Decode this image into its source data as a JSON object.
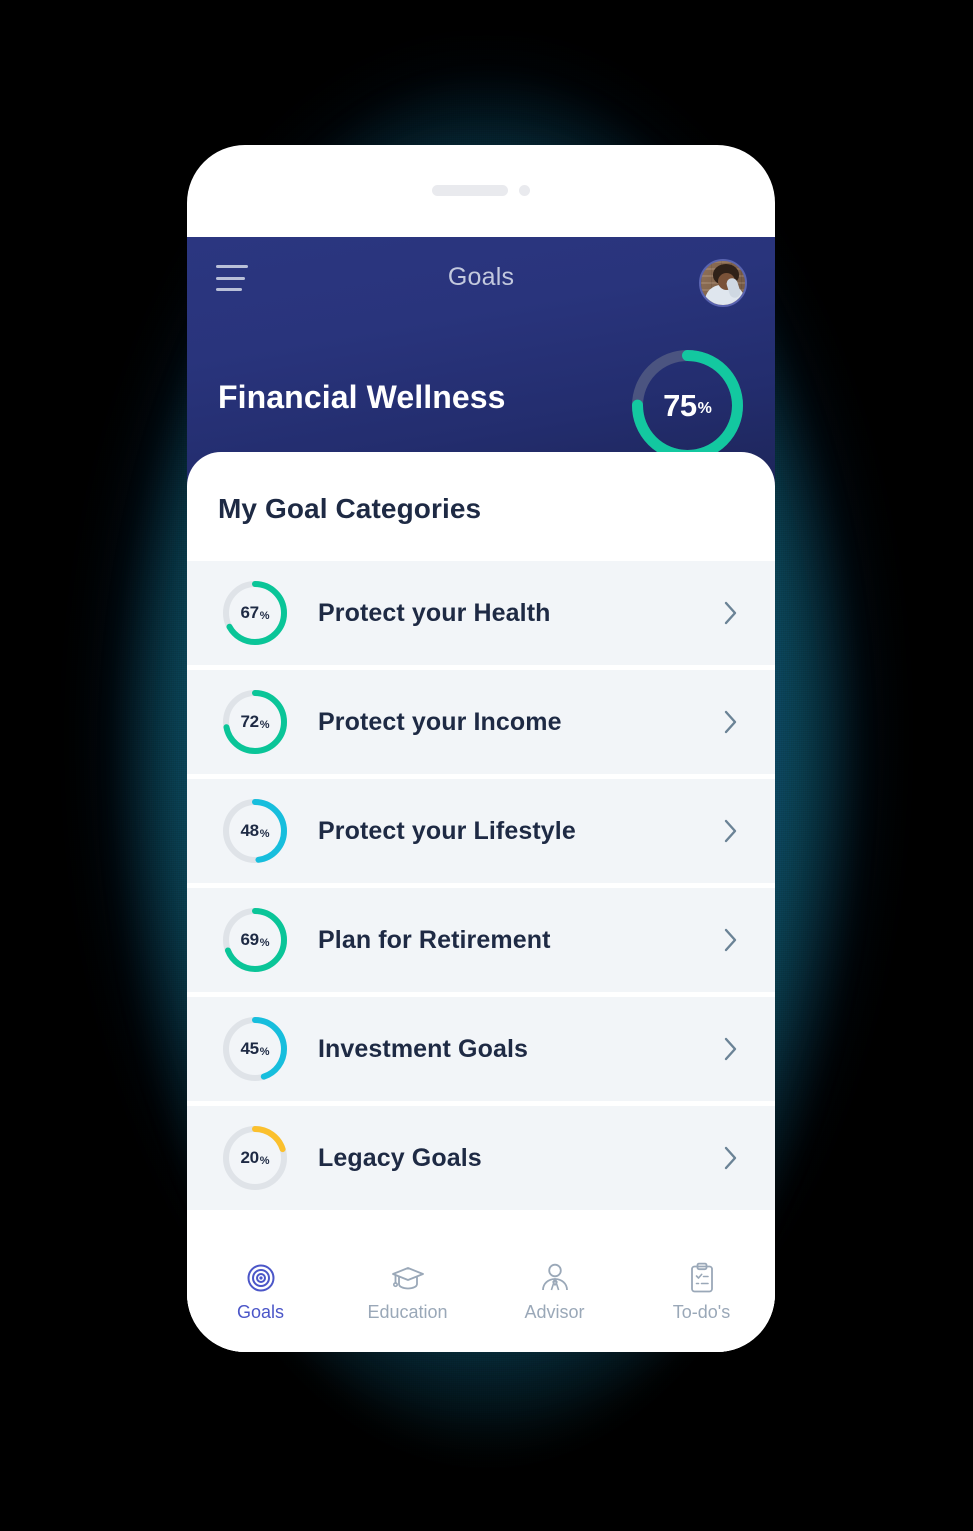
{
  "device": {
    "speaker_icon": "speaker-grille",
    "camera_icon": "front-camera-dot"
  },
  "header": {
    "menu_icon": "hamburger-menu-icon",
    "title": "Goals",
    "avatar_icon": "user-avatar-photo",
    "wellness_title": "Financial Wellness",
    "wellness_value": "75",
    "wellness_unit": "%",
    "gauge_percent": 75,
    "gauge_color": "#13c8a0",
    "gauge_track_color": "#4b5480",
    "bg_gradient_from": "#2b3680",
    "bg_gradient_to": "#1d2559"
  },
  "main": {
    "section_title": "My Goal Categories",
    "chevron_icon": "chevron-right-icon",
    "row_bg": "#f2f5f8",
    "text_color": "#1e2a44",
    "ring_track_color": "#dfe3e8",
    "goals": [
      {
        "percent": 67,
        "value": "67",
        "unit": "%",
        "label": "Protect your Health",
        "color": "#0ac598"
      },
      {
        "percent": 72,
        "value": "72",
        "unit": "%",
        "label": "Protect your Income",
        "color": "#0ac598"
      },
      {
        "percent": 48,
        "value": "48",
        "unit": "%",
        "label": "Protect your Lifestyle",
        "color": "#17bedd"
      },
      {
        "percent": 69,
        "value": "69",
        "unit": "%",
        "label": "Plan for Retirement",
        "color": "#0ac598"
      },
      {
        "percent": 45,
        "value": "45",
        "unit": "%",
        "label": "Investment Goals",
        "color": "#17bedd"
      },
      {
        "percent": 20,
        "value": "20",
        "unit": "%",
        "label": "Legacy Goals",
        "color": "#fbc02d"
      }
    ]
  },
  "bottom_nav": {
    "active_color": "#4b56c8",
    "inactive_color": "#9aa8b8",
    "items": [
      {
        "label": "Goals",
        "icon": "target-icon",
        "active": true
      },
      {
        "label": "Education",
        "icon": "graduation-cap-icon",
        "active": false
      },
      {
        "label": "Advisor",
        "icon": "advisor-person-icon",
        "active": false
      },
      {
        "label": "To-do's",
        "icon": "clipboard-check-icon",
        "active": false
      }
    ]
  }
}
